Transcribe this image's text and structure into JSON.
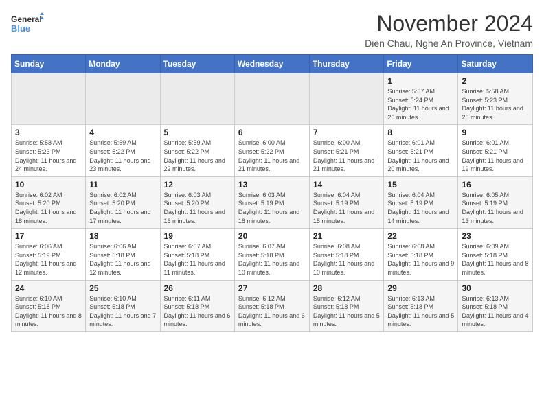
{
  "logo": {
    "line1": "General",
    "line2": "Blue"
  },
  "title": "November 2024",
  "location": "Dien Chau, Nghe An Province, Vietnam",
  "weekdays": [
    "Sunday",
    "Monday",
    "Tuesday",
    "Wednesday",
    "Thursday",
    "Friday",
    "Saturday"
  ],
  "weeks": [
    [
      {
        "day": "",
        "info": ""
      },
      {
        "day": "",
        "info": ""
      },
      {
        "day": "",
        "info": ""
      },
      {
        "day": "",
        "info": ""
      },
      {
        "day": "",
        "info": ""
      },
      {
        "day": "1",
        "info": "Sunrise: 5:57 AM\nSunset: 5:24 PM\nDaylight: 11 hours and 26 minutes."
      },
      {
        "day": "2",
        "info": "Sunrise: 5:58 AM\nSunset: 5:23 PM\nDaylight: 11 hours and 25 minutes."
      }
    ],
    [
      {
        "day": "3",
        "info": "Sunrise: 5:58 AM\nSunset: 5:23 PM\nDaylight: 11 hours and 24 minutes."
      },
      {
        "day": "4",
        "info": "Sunrise: 5:59 AM\nSunset: 5:22 PM\nDaylight: 11 hours and 23 minutes."
      },
      {
        "day": "5",
        "info": "Sunrise: 5:59 AM\nSunset: 5:22 PM\nDaylight: 11 hours and 22 minutes."
      },
      {
        "day": "6",
        "info": "Sunrise: 6:00 AM\nSunset: 5:22 PM\nDaylight: 11 hours and 21 minutes."
      },
      {
        "day": "7",
        "info": "Sunrise: 6:00 AM\nSunset: 5:21 PM\nDaylight: 11 hours and 21 minutes."
      },
      {
        "day": "8",
        "info": "Sunrise: 6:01 AM\nSunset: 5:21 PM\nDaylight: 11 hours and 20 minutes."
      },
      {
        "day": "9",
        "info": "Sunrise: 6:01 AM\nSunset: 5:21 PM\nDaylight: 11 hours and 19 minutes."
      }
    ],
    [
      {
        "day": "10",
        "info": "Sunrise: 6:02 AM\nSunset: 5:20 PM\nDaylight: 11 hours and 18 minutes."
      },
      {
        "day": "11",
        "info": "Sunrise: 6:02 AM\nSunset: 5:20 PM\nDaylight: 11 hours and 17 minutes."
      },
      {
        "day": "12",
        "info": "Sunrise: 6:03 AM\nSunset: 5:20 PM\nDaylight: 11 hours and 16 minutes."
      },
      {
        "day": "13",
        "info": "Sunrise: 6:03 AM\nSunset: 5:19 PM\nDaylight: 11 hours and 16 minutes."
      },
      {
        "day": "14",
        "info": "Sunrise: 6:04 AM\nSunset: 5:19 PM\nDaylight: 11 hours and 15 minutes."
      },
      {
        "day": "15",
        "info": "Sunrise: 6:04 AM\nSunset: 5:19 PM\nDaylight: 11 hours and 14 minutes."
      },
      {
        "day": "16",
        "info": "Sunrise: 6:05 AM\nSunset: 5:19 PM\nDaylight: 11 hours and 13 minutes."
      }
    ],
    [
      {
        "day": "17",
        "info": "Sunrise: 6:06 AM\nSunset: 5:19 PM\nDaylight: 11 hours and 12 minutes."
      },
      {
        "day": "18",
        "info": "Sunrise: 6:06 AM\nSunset: 5:18 PM\nDaylight: 11 hours and 12 minutes."
      },
      {
        "day": "19",
        "info": "Sunrise: 6:07 AM\nSunset: 5:18 PM\nDaylight: 11 hours and 11 minutes."
      },
      {
        "day": "20",
        "info": "Sunrise: 6:07 AM\nSunset: 5:18 PM\nDaylight: 11 hours and 10 minutes."
      },
      {
        "day": "21",
        "info": "Sunrise: 6:08 AM\nSunset: 5:18 PM\nDaylight: 11 hours and 10 minutes."
      },
      {
        "day": "22",
        "info": "Sunrise: 6:08 AM\nSunset: 5:18 PM\nDaylight: 11 hours and 9 minutes."
      },
      {
        "day": "23",
        "info": "Sunrise: 6:09 AM\nSunset: 5:18 PM\nDaylight: 11 hours and 8 minutes."
      }
    ],
    [
      {
        "day": "24",
        "info": "Sunrise: 6:10 AM\nSunset: 5:18 PM\nDaylight: 11 hours and 8 minutes."
      },
      {
        "day": "25",
        "info": "Sunrise: 6:10 AM\nSunset: 5:18 PM\nDaylight: 11 hours and 7 minutes."
      },
      {
        "day": "26",
        "info": "Sunrise: 6:11 AM\nSunset: 5:18 PM\nDaylight: 11 hours and 6 minutes."
      },
      {
        "day": "27",
        "info": "Sunrise: 6:12 AM\nSunset: 5:18 PM\nDaylight: 11 hours and 6 minutes."
      },
      {
        "day": "28",
        "info": "Sunrise: 6:12 AM\nSunset: 5:18 PM\nDaylight: 11 hours and 5 minutes."
      },
      {
        "day": "29",
        "info": "Sunrise: 6:13 AM\nSunset: 5:18 PM\nDaylight: 11 hours and 5 minutes."
      },
      {
        "day": "30",
        "info": "Sunrise: 6:13 AM\nSunset: 5:18 PM\nDaylight: 11 hours and 4 minutes."
      }
    ]
  ]
}
